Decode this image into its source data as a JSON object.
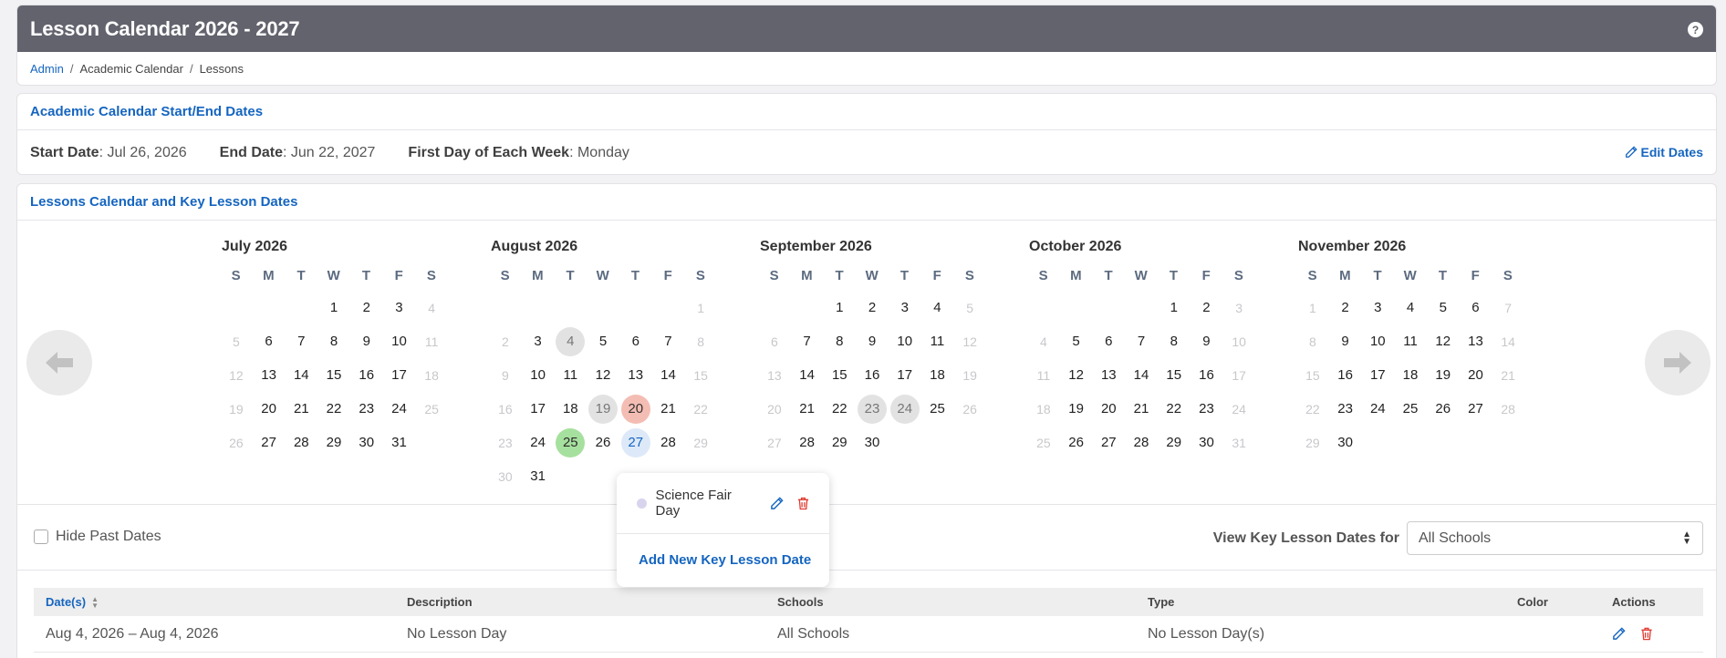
{
  "header": {
    "title": "Lesson Calendar 2026 - 2027",
    "help_glyph": "?"
  },
  "breadcrumb": [
    "Admin",
    "Academic Calendar",
    "Lessons"
  ],
  "dates_panel": {
    "heading": "Academic Calendar Start/End Dates",
    "start_label": "Start Date",
    "start_value": ": Jul 26, 2026",
    "end_label": "End Date",
    "end_value": ": Jun 22, 2027",
    "week_label": "First Day of Each Week",
    "week_value": ": Monday",
    "edit_label": "Edit Dates"
  },
  "calendar": {
    "heading": "Lessons Calendar and Key Lesson Dates",
    "dow": [
      "S",
      "M",
      "T",
      "W",
      "T",
      "F",
      "S"
    ],
    "months": [
      {
        "title": "July 2026",
        "offset": 3,
        "days": 31,
        "highlights": {}
      },
      {
        "title": "August 2026",
        "offset": 6,
        "days": 31,
        "highlights": {
          "4": "grey",
          "19": "grey",
          "20": "red",
          "25": "green",
          "27": "blue"
        }
      },
      {
        "title": "September 2026",
        "offset": 2,
        "days": 30,
        "highlights": {
          "23": "grey",
          "24": "grey"
        }
      },
      {
        "title": "October 2026",
        "offset": 4,
        "days": 31,
        "highlights": {}
      },
      {
        "title": "November 2026",
        "offset": 0,
        "days": 30,
        "highlights": {}
      }
    ]
  },
  "popover": {
    "item_label": "Science Fair Day",
    "dot_color": "#d9d4ee",
    "add_label": "Add New Key Lesson Date"
  },
  "filters": {
    "hide_past_label": "Hide Past Dates",
    "view_for_label": "View Key Lesson Dates for",
    "view_for_value": "All Schools"
  },
  "table": {
    "headers": [
      "Date(s)",
      "Description",
      "Schools",
      "Type",
      "Color",
      "Actions"
    ],
    "rows": [
      {
        "dates": "Aug 4, 2026 – Aug 4, 2026",
        "description": "No Lesson Day",
        "schools": "All Schools",
        "type": "No Lesson Day(s)",
        "color": ""
      }
    ]
  },
  "colors": {
    "accent": "#1565c0",
    "titlebar": "#62636d",
    "delete": "#e03b32"
  }
}
